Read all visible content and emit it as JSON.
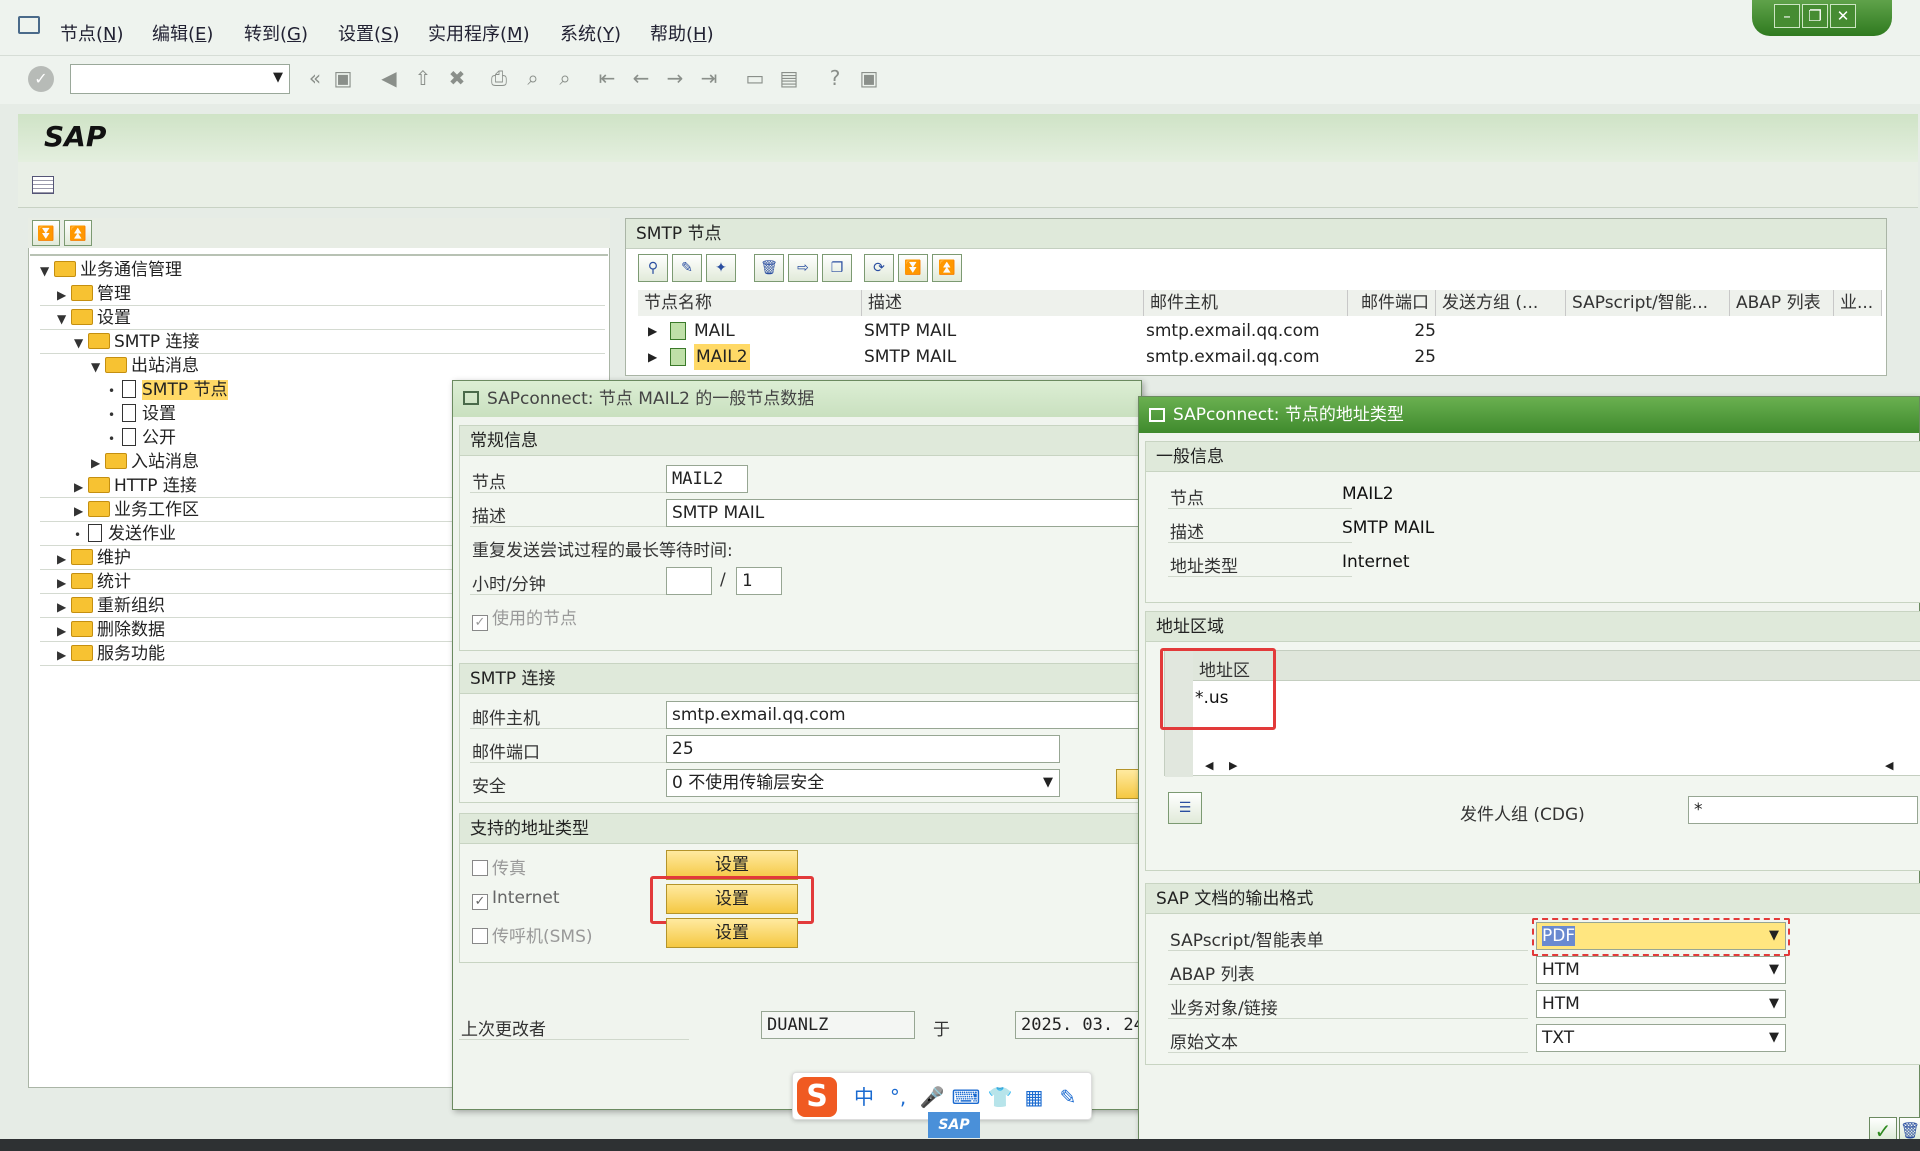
{
  "menu": {
    "items": [
      {
        "label": "节点",
        "key": "N"
      },
      {
        "label": "编辑",
        "key": "E"
      },
      {
        "label": "转到",
        "key": "G"
      },
      {
        "label": "设置",
        "key": "S"
      },
      {
        "label": "实用程序",
        "key": "M"
      },
      {
        "label": "系统",
        "key": "Y"
      },
      {
        "label": "帮助",
        "key": "H"
      }
    ]
  },
  "app_title": "SAP",
  "tree": {
    "items": [
      {
        "label": "业务通信管理",
        "type": "folder",
        "level": 0,
        "state": "open"
      },
      {
        "label": "管理",
        "type": "folder",
        "level": 1,
        "state": "closed"
      },
      {
        "label": "设置",
        "type": "folder",
        "level": 1,
        "state": "open"
      },
      {
        "label": "SMTP 连接",
        "type": "folder",
        "level": 2,
        "state": "open"
      },
      {
        "label": "出站消息",
        "type": "folder",
        "level": 3,
        "state": "open"
      },
      {
        "label": "SMTP 节点",
        "type": "doc",
        "level": 4,
        "state": "leaf",
        "selected": true
      },
      {
        "label": "设置",
        "type": "doc",
        "level": 4,
        "state": "leaf"
      },
      {
        "label": "公开",
        "type": "doc",
        "level": 4,
        "state": "leaf"
      },
      {
        "label": "入站消息",
        "type": "folder",
        "level": 3,
        "state": "closed"
      },
      {
        "label": "HTTP 连接",
        "type": "folder",
        "level": 2,
        "state": "closed"
      },
      {
        "label": "业务工作区",
        "type": "folder",
        "level": 2,
        "state": "closed"
      },
      {
        "label": "发送作业",
        "type": "doc",
        "level": 2,
        "state": "leaf"
      },
      {
        "label": "维护",
        "type": "folder",
        "level": 1,
        "state": "closed"
      },
      {
        "label": "统计",
        "type": "folder",
        "level": 1,
        "state": "closed"
      },
      {
        "label": "重新组织",
        "type": "folder",
        "level": 1,
        "state": "closed"
      },
      {
        "label": "删除数据",
        "type": "folder",
        "level": 1,
        "state": "closed"
      },
      {
        "label": "服务功能",
        "type": "folder",
        "level": 1,
        "state": "closed"
      }
    ]
  },
  "smtp_panel": {
    "title": "SMTP 节点",
    "columns": [
      "节点名称",
      "描述",
      "邮件主机",
      "邮件端口",
      "发送方组 (...",
      "SAPscript/智能...",
      "ABAP 列表",
      "业..."
    ],
    "rows": [
      {
        "name": "MAIL",
        "desc": "SMTP MAIL",
        "host": "smtp.exmail.qq.com",
        "port": "25"
      },
      {
        "name": "MAIL2",
        "desc": "SMTP MAIL",
        "host": "smtp.exmail.qq.com",
        "port": "25"
      }
    ]
  },
  "dialog1": {
    "title": "SAPconnect: 节点 MAIL2 的一般节点数据",
    "general": {
      "title": "常规信息",
      "node_label": "节点",
      "node_value": "MAIL2",
      "desc_label": "描述",
      "desc_value": "SMTP MAIL",
      "retry_label": "重复发送尝试过程的最长等待时间:",
      "hm_label": "小时/分钟",
      "hours": "",
      "minutes": "1",
      "slash": "/",
      "used_label": "使用的节点"
    },
    "smtp": {
      "title": "SMTP 连接",
      "host_label": "邮件主机",
      "host_value": "smtp.exmail.qq.com",
      "port_label": "邮件端口",
      "port_value": "25",
      "security_label": "安全",
      "security_value": "0 不使用传输层安全"
    },
    "addr": {
      "title": "支持的地址类型",
      "fax_label": "传真",
      "internet_label": "Internet",
      "sms_label": "传呼机(SMS)",
      "btn": "设置"
    },
    "changed_by_label": "上次更改者",
    "changed_by": "DUANLZ",
    "on_label": "于",
    "changed_on": "2025. 03. 24"
  },
  "dialog2": {
    "title": "SAPconnect: 节点的地址类型",
    "general": {
      "title": "一般信息",
      "node_label": "节点",
      "node_value": "MAIL2",
      "desc_label": "描述",
      "desc_value": "SMTP MAIL",
      "type_label": "地址类型",
      "type_value": "Internet"
    },
    "area": {
      "title": "地址区域",
      "col": "地址区",
      "value": "*.us",
      "cdg_label": "发件人组 (CDG)",
      "cdg_value": "*"
    },
    "format": {
      "title": "SAP 文档的输出格式",
      "rows": [
        {
          "label": "SAPscript/智能表单",
          "value": "PDF"
        },
        {
          "label": "ABAP 列表",
          "value": "HTM"
        },
        {
          "label": "业务对象/链接",
          "value": "HTM"
        },
        {
          "label": "原始文本",
          "value": "TXT"
        }
      ]
    }
  },
  "ime": {
    "logo": "S",
    "items": [
      "中",
      "°,",
      "🎤",
      "⌨",
      "👕",
      "▦",
      "✎"
    ]
  },
  "colors": {
    "sap_green": "#3f8a2d",
    "highlight": "#ffd966",
    "red_box": "#e23a3a",
    "button_yellow": "#f5c842"
  }
}
